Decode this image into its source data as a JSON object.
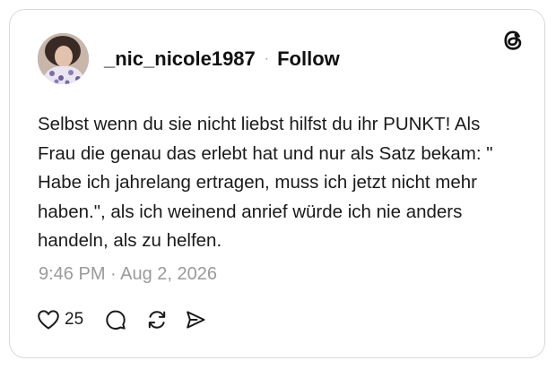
{
  "post": {
    "author": {
      "username": "_nic_nicole1987",
      "separator": "·",
      "follow_label": "Follow",
      "avatar_icon": "profile-photo"
    },
    "text": "Selbst wenn du sie nicht liebst hilfst du ihr PUNKT! Als Frau die genau das erlebt hat und nur als Satz bekam: \" Habe ich jahrelang ertragen, muss ich jetzt nicht mehr haben.\", als ich weinend anrief würde ich nie anders handeln, als zu helfen.",
    "timestamp": "9:46 PM · Aug 2, 2026",
    "actions": {
      "like_icon": "heart-icon",
      "like_count": "25",
      "reply_icon": "comment-icon",
      "repost_icon": "repost-icon",
      "share_icon": "share-icon"
    }
  },
  "brand": {
    "logo": "threads-logo"
  },
  "colors": {
    "text": "#111111",
    "muted": "#9a9a9a",
    "border": "#d9d9d9",
    "background": "#ffffff"
  }
}
